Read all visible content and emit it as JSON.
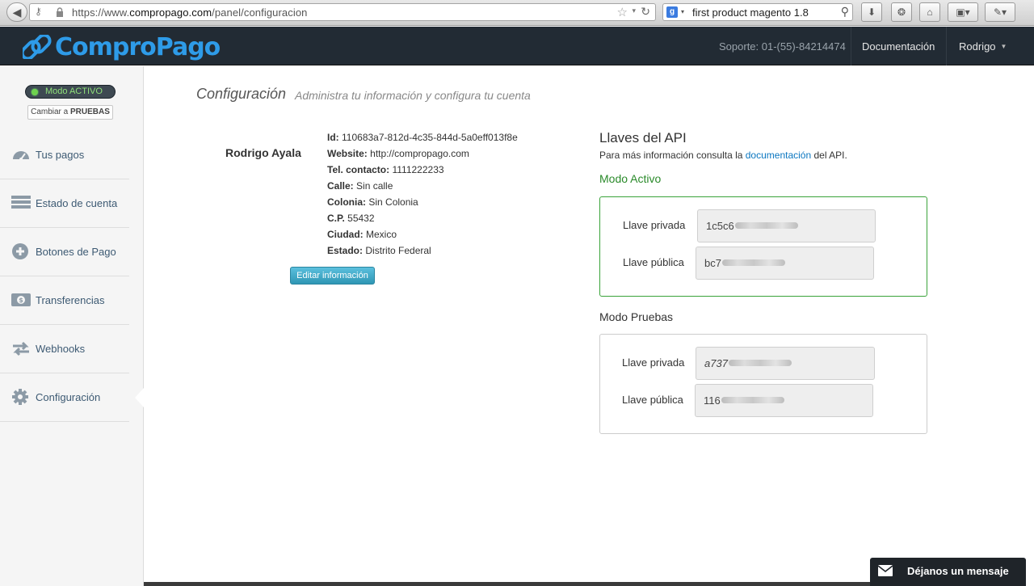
{
  "browser": {
    "url_prefix": "https://www.",
    "url_domain": "compropago.com",
    "url_path": "/panel/configuracion",
    "search_value": "first product magento 1.8",
    "search_engine": "g-icon"
  },
  "header": {
    "brand": "ComproPago",
    "support": "Soporte: 01-(55)-84214474",
    "docs_link": "Documentación",
    "user_menu": "Rodrigo"
  },
  "sidebar": {
    "mode_status": "Modo ACTIVO",
    "switch_prefix": "Cambiar a ",
    "switch_target": "PRUEBAS",
    "items": [
      {
        "label": "Tus pagos",
        "icon": "dashboard-icon"
      },
      {
        "label": "Estado de cuenta",
        "icon": "list-icon"
      },
      {
        "label": "Botones de Pago",
        "icon": "plus-circle-icon"
      },
      {
        "label": "Transferencias",
        "icon": "money-icon"
      },
      {
        "label": "Webhooks",
        "icon": "exchange-icon"
      },
      {
        "label": "Configuración",
        "icon": "gear-icon"
      }
    ]
  },
  "page": {
    "title": "Configuración",
    "subtitle": "Administra tu información y configura tu cuenta"
  },
  "profile": {
    "name": "Rodrigo Ayala",
    "fields": [
      {
        "label": "Id:",
        "value": "110683a7-812d-4c35-844d-5a0eff013f8e"
      },
      {
        "label": "Website:",
        "value": "http://compropago.com"
      },
      {
        "label": "Tel. contacto:",
        "value": "1111222233"
      },
      {
        "label": "Calle:",
        "value": "Sin calle"
      },
      {
        "label": "Colonia:",
        "value": "Sin Colonia"
      },
      {
        "label": "C.P.",
        "value": "55432"
      },
      {
        "label": "Ciudad:",
        "value": "Mexico"
      },
      {
        "label": "Estado:",
        "value": "Distrito Federal"
      }
    ],
    "edit_button": "Editar información"
  },
  "api": {
    "title": "Llaves del API",
    "desc_before": "Para más información consulta la ",
    "desc_link": "documentación",
    "desc_after": " del API.",
    "active": {
      "heading": "Modo Activo",
      "private_label": "Llave privada",
      "private_value": "1c5c6",
      "public_label": "Llave pública",
      "public_value": "bc7"
    },
    "test": {
      "heading": "Modo Pruebas",
      "private_label": "Llave privada",
      "private_value": "a737",
      "public_label": "Llave pública",
      "public_value": "116"
    }
  },
  "chat": {
    "label": "Déjanos un mensaje"
  },
  "colors": {
    "brand_blue": "#2e9be8",
    "active_green": "#2a8a2a",
    "nav_bg": "#222b34",
    "link_blue": "#0a76c0"
  }
}
